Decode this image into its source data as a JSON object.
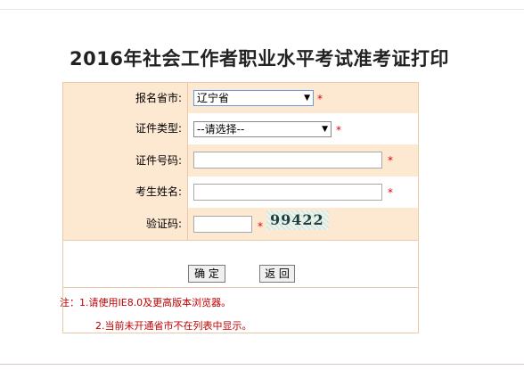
{
  "page": {
    "title": "2016年社会工作者职业水平考试准考证打印"
  },
  "form": {
    "fields": [
      {
        "label": "报名省市:",
        "type": "select",
        "value": "辽宁省",
        "required_mark": "*"
      },
      {
        "label": "证件类型:",
        "type": "select",
        "value": "--请选择--",
        "required_mark": "*"
      },
      {
        "label": "证件号码:",
        "type": "text",
        "value": "",
        "required_mark": "*"
      },
      {
        "label": "考生姓名:",
        "type": "text",
        "value": "",
        "required_mark": "*"
      },
      {
        "label": "验证码:",
        "type": "text",
        "value": "",
        "required_mark": "*"
      }
    ],
    "captcha_text": "99422",
    "buttons": {
      "confirm": "确 定",
      "back": "返 回"
    },
    "notes": [
      "注：1.请使用IE8.0及更高版本浏览器。",
      "2.当前未开通省市不在列表中显示。"
    ]
  },
  "colors": {
    "label_bg": "#fde8d2",
    "border": "#e9c9a8",
    "required": "#d8000f",
    "note_text": "#c00000"
  },
  "icons": {
    "dropdown": "triangle-down"
  }
}
